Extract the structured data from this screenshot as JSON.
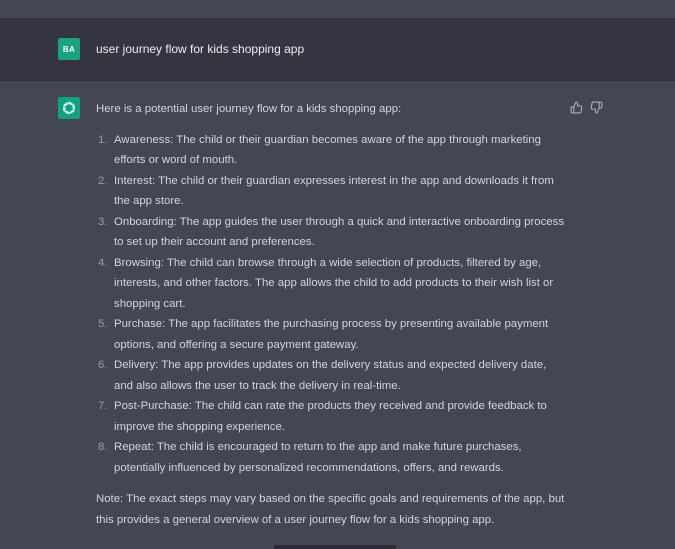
{
  "user_message": {
    "avatar_initials": "BA",
    "text": "user journey flow for kids shopping app"
  },
  "assistant_message": {
    "intro": "Here is a potential user journey flow for a kids shopping app:",
    "steps": [
      {
        "num": "1.",
        "text": "Awareness: The child or their guardian becomes aware of the app through marketing efforts or word of mouth."
      },
      {
        "num": "2.",
        "text": "Interest: The child or their guardian expresses interest in the app and downloads it from the app store."
      },
      {
        "num": "3.",
        "text": "Onboarding: The app guides the user through a quick and interactive onboarding process to set up their account and preferences."
      },
      {
        "num": "4.",
        "text": "Browsing: The child can browse through a wide selection of products, filtered by age, interests, and other factors. The app allows the child to add products to their wish list or shopping cart."
      },
      {
        "num": "5.",
        "text": "Purchase: The app facilitates the purchasing process by presenting available payment options, and offering a secure payment gateway."
      },
      {
        "num": "6.",
        "text": "Delivery: The app provides updates on the delivery status and expected delivery date, and also allows the user to track the delivery in real-time."
      },
      {
        "num": "7.",
        "text": "Post-Purchase: The child can rate the products they received and provide feedback to improve the shopping experience."
      },
      {
        "num": "8.",
        "text": "Repeat: The child is encouraged to return to the app and make future purchases, potentially influenced by personalized recommendations, offers, and rewards."
      }
    ],
    "note": "Note: The exact steps may vary based on the specific goals and requirements of the app, but this provides a general overview of a user journey flow for a kids shopping app."
  },
  "icons": {
    "assistant_avatar": "openai-logo-icon",
    "thumbs_up": "thumbs-up-icon",
    "thumbs_down": "thumbs-down-icon"
  },
  "colors": {
    "user_avatar_bg": "#19a37f",
    "assistant_avatar_bg": "#10a37f",
    "user_row_bg": "#343541",
    "assistant_row_bg": "#444654"
  }
}
